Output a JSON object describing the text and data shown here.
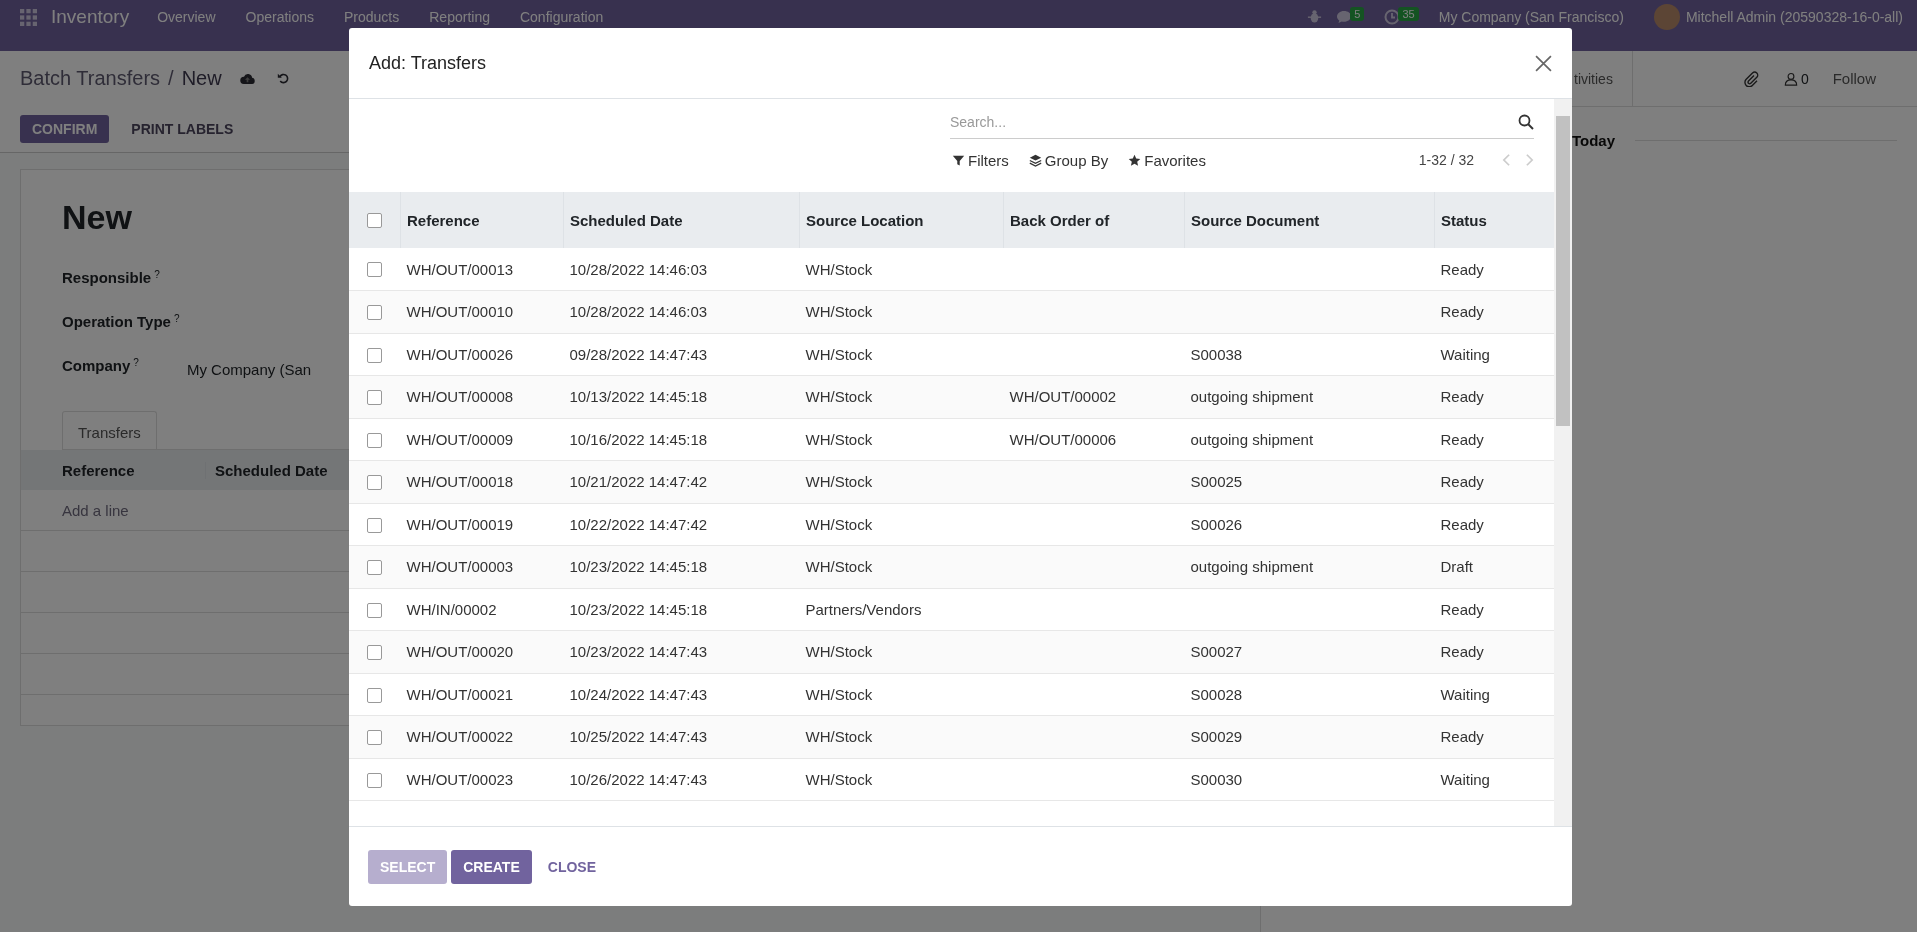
{
  "navbar": {
    "app_name": "Inventory",
    "menu": [
      "Overview",
      "Operations",
      "Products",
      "Reporting",
      "Configuration"
    ],
    "badges": [
      {
        "kind": "chat",
        "count": "5"
      },
      {
        "kind": "clock",
        "count": "35"
      }
    ],
    "company": "My Company (San Francisco)",
    "user": "Mitchell Admin (20590328-16-0-all)"
  },
  "form": {
    "breadcrumb": [
      "Batch Transfers",
      "New"
    ],
    "breadcrumb_separator": "/",
    "buttons": [
      {
        "label": "CONFIRM",
        "kind": "primary"
      },
      {
        "label": "PRINT LABELS",
        "kind": "secondary"
      }
    ],
    "title": "New",
    "fields": [
      {
        "label": "Responsible",
        "help": "?"
      },
      {
        "label": "Operation Type",
        "help": "?"
      },
      {
        "label": "Company",
        "help": "?",
        "value": "My Company (San"
      }
    ],
    "tab": "Transfers",
    "columns": [
      "Reference",
      "Scheduled Date"
    ],
    "add_line": "Add a line"
  },
  "chatter": {
    "activities": "tivities",
    "followers": "0",
    "follow": "Follow",
    "date_separator": "Today"
  },
  "dialog": {
    "title": "Add: Transfers",
    "search": {
      "placeholder": "Search..."
    },
    "filters": [
      {
        "kind": "filter",
        "label": "Filters"
      },
      {
        "kind": "group",
        "label": "Group By"
      },
      {
        "kind": "favorite",
        "label": "Favorites"
      }
    ],
    "pager": "1-32 / 32",
    "all_selected": false,
    "columns": [
      "Reference",
      "Scheduled Date",
      "Source Location",
      "Back Order of",
      "Source Document",
      "Status"
    ],
    "rows": [
      {
        "selected": false,
        "cells": [
          "WH/OUT/00013",
          "10/28/2022 14:46:03",
          "WH/Stock",
          "",
          "",
          "Ready"
        ]
      },
      {
        "selected": false,
        "cells": [
          "WH/OUT/00010",
          "10/28/2022 14:46:03",
          "WH/Stock",
          "",
          "",
          "Ready"
        ]
      },
      {
        "selected": false,
        "cells": [
          "WH/OUT/00026",
          "09/28/2022 14:47:43",
          "WH/Stock",
          "",
          "S00038",
          "Waiting"
        ]
      },
      {
        "selected": false,
        "cells": [
          "WH/OUT/00008",
          "10/13/2022 14:45:18",
          "WH/Stock",
          "WH/OUT/00002",
          "outgoing shipment",
          "Ready"
        ]
      },
      {
        "selected": false,
        "cells": [
          "WH/OUT/00009",
          "10/16/2022 14:45:18",
          "WH/Stock",
          "WH/OUT/00006",
          "outgoing shipment",
          "Ready"
        ]
      },
      {
        "selected": false,
        "cells": [
          "WH/OUT/00018",
          "10/21/2022 14:47:42",
          "WH/Stock",
          "",
          "S00025",
          "Ready"
        ]
      },
      {
        "selected": false,
        "cells": [
          "WH/OUT/00019",
          "10/22/2022 14:47:42",
          "WH/Stock",
          "",
          "S00026",
          "Ready"
        ]
      },
      {
        "selected": false,
        "cells": [
          "WH/OUT/00003",
          "10/23/2022 14:45:18",
          "WH/Stock",
          "",
          "outgoing shipment",
          "Draft"
        ]
      },
      {
        "selected": false,
        "cells": [
          "WH/IN/00002",
          "10/23/2022 14:45:18",
          "Partners/Vendors",
          "",
          "",
          "Ready"
        ]
      },
      {
        "selected": false,
        "cells": [
          "WH/OUT/00020",
          "10/23/2022 14:47:43",
          "WH/Stock",
          "",
          "S00027",
          "Ready"
        ]
      },
      {
        "selected": false,
        "cells": [
          "WH/OUT/00021",
          "10/24/2022 14:47:43",
          "WH/Stock",
          "",
          "S00028",
          "Waiting"
        ]
      },
      {
        "selected": false,
        "cells": [
          "WH/OUT/00022",
          "10/25/2022 14:47:43",
          "WH/Stock",
          "",
          "S00029",
          "Ready"
        ]
      },
      {
        "selected": false,
        "cells": [
          "WH/OUT/00023",
          "10/26/2022 14:47:43",
          "WH/Stock",
          "",
          "S00030",
          "Waiting"
        ]
      }
    ],
    "buttons": [
      {
        "label": "SELECT",
        "kind": "primary",
        "disabled": true
      },
      {
        "label": "CREATE",
        "kind": "primary",
        "disabled": false
      },
      {
        "label": "CLOSE",
        "kind": "link",
        "disabled": false
      }
    ]
  }
}
